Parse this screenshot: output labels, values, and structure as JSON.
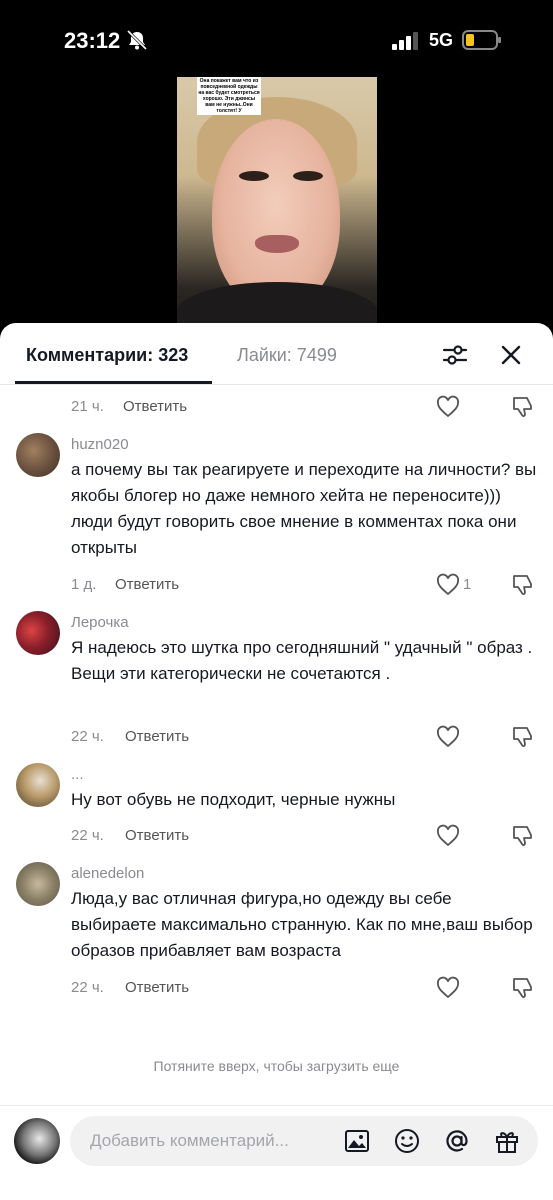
{
  "status_bar": {
    "time": "23:12",
    "network": "5G",
    "icons": [
      "bell-slash-icon",
      "signal-bars-icon",
      "battery-low-icon"
    ],
    "battery_color": "#f5c518"
  },
  "video": {
    "caption": "Она покажет вам что из повседневной одежды на вас будет смотреться хорошо. Эти джинсы вам не нужны..Они толстят! У"
  },
  "tabs": {
    "comments": "Комментарии: 323",
    "likes": "Лайки: 7499"
  },
  "header_icons": [
    "sliders-icon",
    "close-icon"
  ],
  "comments": [
    {
      "user": "",
      "text": "",
      "age": "21 ч.",
      "reply": "Ответить",
      "likes": ""
    },
    {
      "user": "huzn020",
      "text": "а почему вы так реагируете и переходите на личности? вы якобы блогер но даже немного хейта не переносите))) люди будут говорить свое мнение в комментах пока они открыты",
      "age": "1 д.",
      "reply": "Ответить",
      "likes": "1"
    },
    {
      "user": "Лерочка",
      "text": "Я надеюсь это шутка про сегодняшний \" удачный \" образ .\nВещи эти категорически не сочетаются .",
      "age": "22 ч.",
      "reply": "Ответить",
      "likes": ""
    },
    {
      "user": "...",
      "text": "Ну вот обувь не подходит, черные нужны",
      "age": "22 ч.",
      "reply": "Ответить",
      "likes": ""
    },
    {
      "user": "alenedelon",
      "text": "Люда,у вас отличная фигура,но одежду вы себе выбираете максимально странную. Как по мне,ваш выбор образов прибавляет вам возраста",
      "age": "22 ч.",
      "reply": "Ответить",
      "likes": ""
    }
  ],
  "load_more": "Потяните вверх, чтобы загрузить еще",
  "composer": {
    "placeholder": "Добавить комментарий...",
    "icons": [
      "image-icon",
      "emoji-icon",
      "mention-icon",
      "gift-icon"
    ]
  },
  "colors": {
    "text": "#161823",
    "secondary": "#8a8b91",
    "sheet_bg": "#ffffff",
    "input_bg": "#f1f1f2"
  }
}
